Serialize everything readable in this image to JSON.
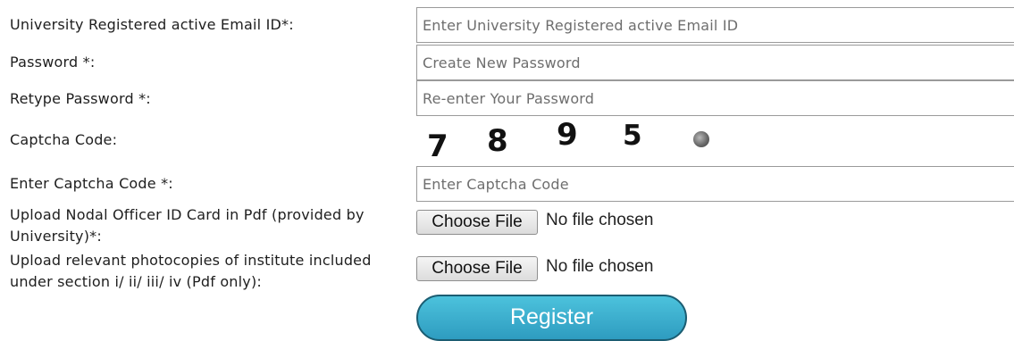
{
  "form": {
    "email_label": "University Registered active Email ID*:",
    "email_placeholder": "Enter University Registered active Email ID",
    "password_label": "Password *:",
    "password_placeholder": "Create New Password",
    "retype_label": "Retype Password *:",
    "retype_placeholder": "Re-enter Your Password",
    "captcha_label": "Captcha Code:",
    "captcha_digits": [
      "7",
      "8",
      "9",
      "5"
    ],
    "enter_captcha_label": "Enter Captcha Code *:",
    "enter_captcha_placeholder": "Enter Captcha Code",
    "id_card_label": "Upload Nodal Officer ID Card in Pdf (provided by University)*:",
    "photocopies_label": "Upload relevant photocopies of institute included under section i/ ii/ iii/ iv (Pdf only):",
    "choose_file_label": "Choose File",
    "no_file_text": "No file chosen",
    "register_label": "Register"
  },
  "icons": {
    "captcha_refresh": "refresh-icon"
  },
  "colors": {
    "register_button": "#3bb0d0",
    "register_border": "#1b5d72"
  }
}
